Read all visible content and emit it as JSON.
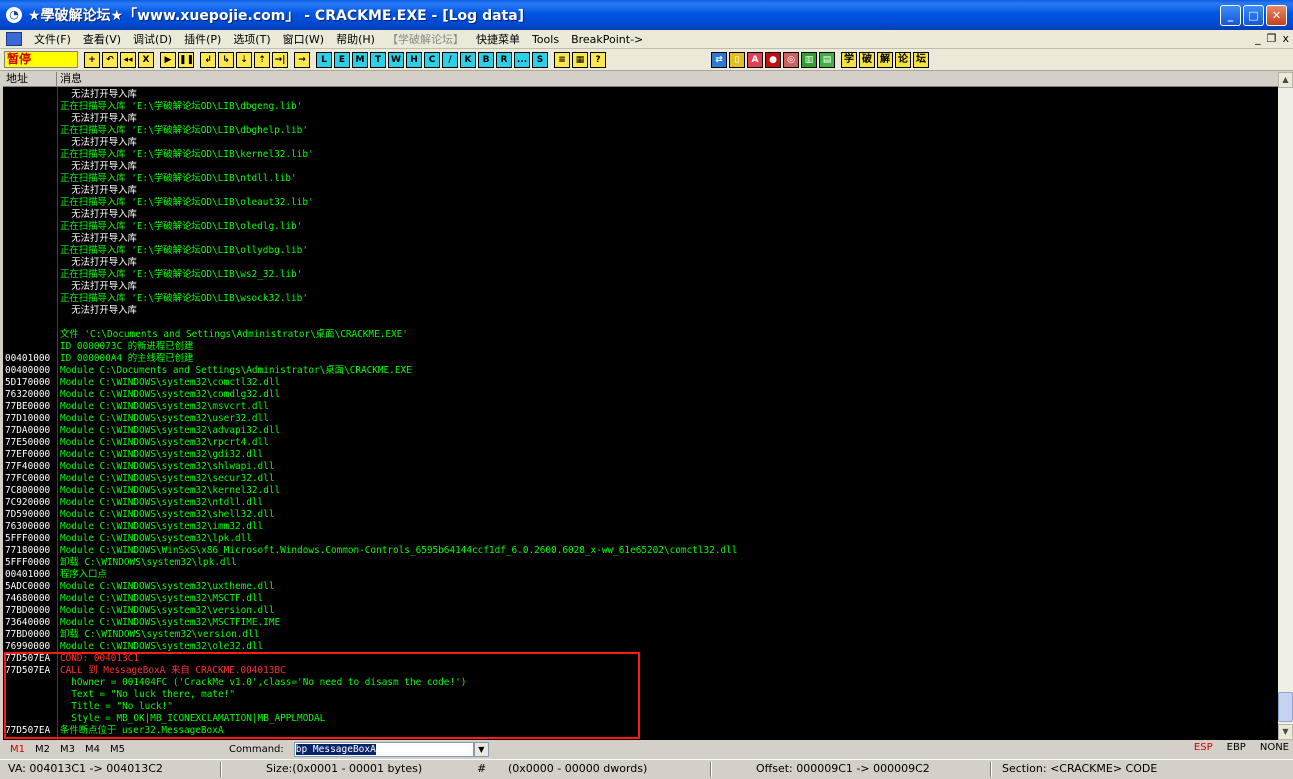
{
  "window": {
    "title": "★學破解论坛★「www.xuepojie.com」 - CRACKME.EXE - [Log data]",
    "icon": "app-logo",
    "buttons": [
      "minimize",
      "maximize",
      "close"
    ]
  },
  "menu": {
    "items": [
      "文件(F)",
      "查看(V)",
      "调试(D)",
      "插件(P)",
      "选项(T)",
      "窗口(W)",
      "帮助(H)",
      "【学破解论坛】",
      "快捷菜单",
      "Tools",
      "BreakPoint->"
    ],
    "mdi": [
      "_",
      "❐",
      "x"
    ]
  },
  "toolbar": {
    "status": "暂停",
    "group1": [
      "+",
      "↶",
      "◂◂",
      "X"
    ],
    "group2": [
      "▶",
      "❚❚"
    ],
    "group3": [
      "↲",
      "↳",
      "⇣",
      "⇡",
      "→|"
    ],
    "group4": [
      "→"
    ],
    "letters": [
      "L",
      "E",
      "M",
      "T",
      "W",
      "H",
      "C",
      "/",
      "K",
      "B",
      "R",
      "...",
      "S"
    ],
    "group5": [
      "≡",
      "▦",
      "?"
    ],
    "right_icons": [
      "⇄",
      "▯",
      "A",
      "●",
      "◎",
      "▥",
      "▤"
    ],
    "cjk": [
      "学",
      "破",
      "解",
      "论",
      "坛"
    ]
  },
  "log_header": {
    "address": "地址",
    "message": "消息"
  },
  "log_rows": [
    {
      "addr": "",
      "msg": "  无法打开导入库",
      "color": "white"
    },
    {
      "addr": "",
      "msg": "正在扫描导入库 'E:\\学破解论坛OD\\LIB\\dbgeng.lib'",
      "color": "green"
    },
    {
      "addr": "",
      "msg": "  无法打开导入库",
      "color": "white"
    },
    {
      "addr": "",
      "msg": "正在扫描导入库 'E:\\学破解论坛OD\\LIB\\dbghelp.lib'",
      "color": "green"
    },
    {
      "addr": "",
      "msg": "  无法打开导入库",
      "color": "white"
    },
    {
      "addr": "",
      "msg": "正在扫描导入库 'E:\\学破解论坛OD\\LIB\\kernel32.lib'",
      "color": "green"
    },
    {
      "addr": "",
      "msg": "  无法打开导入库",
      "color": "white"
    },
    {
      "addr": "",
      "msg": "正在扫描导入库 'E:\\学破解论坛OD\\LIB\\ntdll.lib'",
      "color": "green"
    },
    {
      "addr": "",
      "msg": "  无法打开导入库",
      "color": "white"
    },
    {
      "addr": "",
      "msg": "正在扫描导入库 'E:\\学破解论坛OD\\LIB\\oleaut32.lib'",
      "color": "green"
    },
    {
      "addr": "",
      "msg": "  无法打开导入库",
      "color": "white"
    },
    {
      "addr": "",
      "msg": "正在扫描导入库 'E:\\学破解论坛OD\\LIB\\oledlg.lib'",
      "color": "green"
    },
    {
      "addr": "",
      "msg": "  无法打开导入库",
      "color": "white"
    },
    {
      "addr": "",
      "msg": "正在扫描导入库 'E:\\学破解论坛OD\\LIB\\ollydbg.lib'",
      "color": "green"
    },
    {
      "addr": "",
      "msg": "  无法打开导入库",
      "color": "white"
    },
    {
      "addr": "",
      "msg": "正在扫描导入库 'E:\\学破解论坛OD\\LIB\\ws2_32.lib'",
      "color": "green"
    },
    {
      "addr": "",
      "msg": "  无法打开导入库",
      "color": "white"
    },
    {
      "addr": "",
      "msg": "正在扫描导入库 'E:\\学破解论坛OD\\LIB\\wsock32.lib'",
      "color": "green"
    },
    {
      "addr": "",
      "msg": "  无法打开导入库",
      "color": "white"
    },
    {
      "addr": "",
      "msg": "",
      "color": "white"
    },
    {
      "addr": "",
      "msg": "文件 'C:\\Documents and Settings\\Administrator\\桌面\\CRACKME.EXE'",
      "color": "green"
    },
    {
      "addr": "",
      "msg": "ID 0000073C 的新进程已创建",
      "color": "green"
    },
    {
      "addr": "00401000",
      "msg": "ID 000000A4 的主线程已创建",
      "color": "green"
    },
    {
      "addr": "00400000",
      "msg": "Module C:\\Documents and Settings\\Administrator\\桌面\\CRACKME.EXE",
      "color": "green"
    },
    {
      "addr": "5D170000",
      "msg": "Module C:\\WINDOWS\\system32\\comctl32.dll",
      "color": "green"
    },
    {
      "addr": "76320000",
      "msg": "Module C:\\WINDOWS\\system32\\comdlg32.dll",
      "color": "green"
    },
    {
      "addr": "77BE0000",
      "msg": "Module C:\\WINDOWS\\system32\\msvcrt.dll",
      "color": "green"
    },
    {
      "addr": "77D10000",
      "msg": "Module C:\\WINDOWS\\system32\\user32.dll",
      "color": "green"
    },
    {
      "addr": "77DA0000",
      "msg": "Module C:\\WINDOWS\\system32\\advapi32.dll",
      "color": "green"
    },
    {
      "addr": "77E50000",
      "msg": "Module C:\\WINDOWS\\system32\\rpcrt4.dll",
      "color": "green"
    },
    {
      "addr": "77EF0000",
      "msg": "Module C:\\WINDOWS\\system32\\gdi32.dll",
      "color": "green"
    },
    {
      "addr": "77F40000",
      "msg": "Module C:\\WINDOWS\\system32\\shlwapi.dll",
      "color": "green"
    },
    {
      "addr": "77FC0000",
      "msg": "Module C:\\WINDOWS\\system32\\secur32.dll",
      "color": "green"
    },
    {
      "addr": "7C800000",
      "msg": "Module C:\\WINDOWS\\system32\\kernel32.dll",
      "color": "green"
    },
    {
      "addr": "7C920000",
      "msg": "Module C:\\WINDOWS\\system32\\ntdll.dll",
      "color": "green"
    },
    {
      "addr": "7D590000",
      "msg": "Module C:\\WINDOWS\\system32\\shell32.dll",
      "color": "green"
    },
    {
      "addr": "76300000",
      "msg": "Module C:\\WINDOWS\\system32\\imm32.dll",
      "color": "green"
    },
    {
      "addr": "5FFF0000",
      "msg": "Module C:\\WINDOWS\\system32\\lpk.dll",
      "color": "green"
    },
    {
      "addr": "77180000",
      "msg": "Module C:\\WINDOWS\\WinSxS\\x86_Microsoft.Windows.Common-Controls_6595b64144ccf1df_6.0.2600.6028_x-ww_61e65202\\comctl32.dll",
      "color": "green"
    },
    {
      "addr": "5FFF0000",
      "msg": "卸载 C:\\WINDOWS\\system32\\lpk.dll",
      "color": "green"
    },
    {
      "addr": "00401000",
      "msg": "程序入口点",
      "color": "green"
    },
    {
      "addr": "5ADC0000",
      "msg": "Module C:\\WINDOWS\\system32\\uxtheme.dll",
      "color": "green"
    },
    {
      "addr": "74680000",
      "msg": "Module C:\\WINDOWS\\system32\\MSCTF.dll",
      "color": "green"
    },
    {
      "addr": "77BD0000",
      "msg": "Module C:\\WINDOWS\\system32\\version.dll",
      "color": "green"
    },
    {
      "addr": "73640000",
      "msg": "Module C:\\WINDOWS\\system32\\MSCTFIME.IME",
      "color": "green"
    },
    {
      "addr": "77BD0000",
      "msg": "卸载 C:\\WINDOWS\\system32\\version.dll",
      "color": "green"
    },
    {
      "addr": "76990000",
      "msg": "Module C:\\WINDOWS\\system32\\ole32.dll",
      "color": "green"
    },
    {
      "addr": "77D507EA",
      "msg": "COND: 004013C1",
      "color": "red"
    },
    {
      "addr": "77D507EA",
      "msg": "CALL 到 MessageBoxA 来自 CRACKME.004013BC",
      "color": "red"
    },
    {
      "addr": "",
      "msg": "  hOwner = 001404FC ('CrackMe v1.0',class='No need to disasm the code!')",
      "color": "green"
    },
    {
      "addr": "",
      "msg": "  Text = \"No luck there, mate!\"",
      "color": "green"
    },
    {
      "addr": "",
      "msg": "  Title = \"No luck!\"",
      "color": "green"
    },
    {
      "addr": "",
      "msg": "  Style = MB_OK|MB_ICONEXCLAMATION|MB_APPLMODAL",
      "color": "green"
    },
    {
      "addr": "77D507EA",
      "msg": "条件断点位于 user32.MessageBoxA",
      "color": "green"
    }
  ],
  "command": {
    "tabs": [
      "M1",
      "M2",
      "M3",
      "M4",
      "M5"
    ],
    "label": "Command:",
    "value": "bp MessageBoxA",
    "registers": [
      "ESP",
      "EBP",
      "NONE"
    ]
  },
  "status": {
    "va": "VA: 004013C1 -> 004013C2",
    "size": "Size:(0x0001 - 00001 bytes)",
    "hash": "#",
    "dwords": "(0x0000 - 00000 dwords)",
    "offset": "Offset: 000009C1 -> 000009C2",
    "section": "Section: <CRACKME> CODE"
  }
}
